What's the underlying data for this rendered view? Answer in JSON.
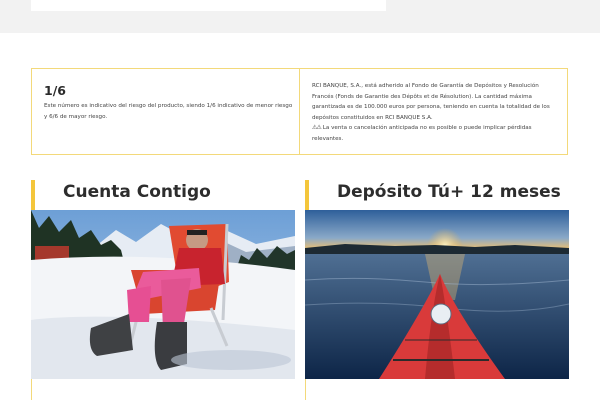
{
  "risk": {
    "title": "1/6",
    "description": "Este número es indicativo del riesgo del producto, siendo 1/6 indicativo de menor riesgo y 6/6 de mayor riesgo."
  },
  "guarantee": {
    "text": "RCI BANQUE, S.A., está adherido al Fondo de Garantía de Depósitos y Resolución Francés (Fonds de Garantie des Dépôts et de Résolution). La cantidad máxima garantizada es de 100.000 euros por persona, teniendo en cuenta la totalidad de los depósitos constituidos en RCI BANQUE S.A.",
    "warning_glyph": "⚠⚠",
    "warning": "La venta o cancelación anticipada no es posible o puede implicar pérdidas relevantes."
  },
  "products": [
    {
      "title": "Cuenta Contigo",
      "image_icon": "snow-lounger-photo"
    },
    {
      "title": "Depósito Tú+ 12 meses",
      "image_icon": "kayak-sunset-photo"
    }
  ],
  "colors": {
    "accent": "#f4c63b",
    "border": "#f3d97a"
  }
}
